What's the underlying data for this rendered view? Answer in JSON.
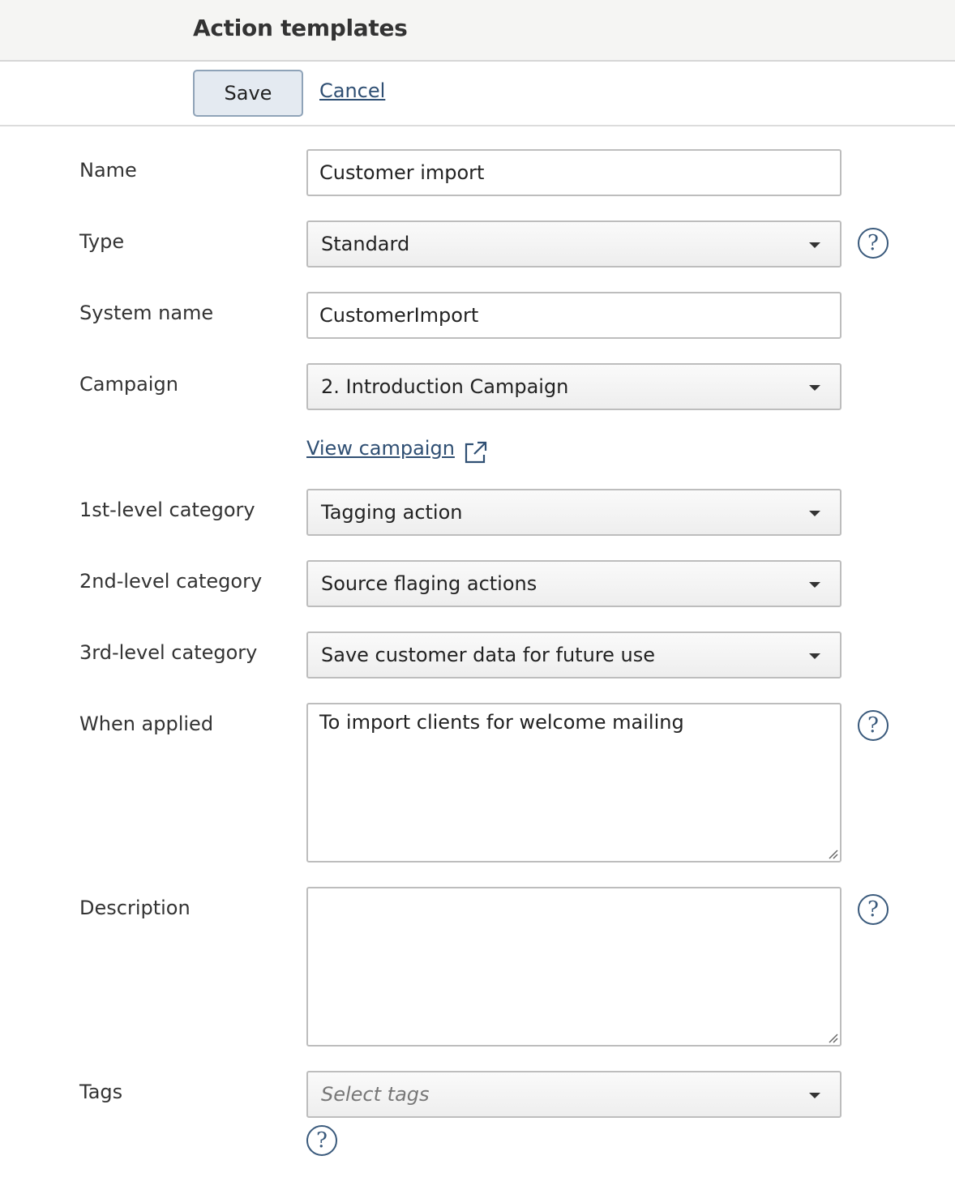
{
  "header": {
    "title": "Action templates"
  },
  "toolbar": {
    "save_label": "Save",
    "cancel_label": "Cancel"
  },
  "form": {
    "name": {
      "label": "Name",
      "value": "Customer import"
    },
    "type": {
      "label": "Type",
      "value": "Standard"
    },
    "system_name": {
      "label": "System name",
      "value": "CustomerImport"
    },
    "campaign": {
      "label": "Campaign",
      "value": "2. Introduction Campaign",
      "view_link": "View campaign"
    },
    "category1": {
      "label": "1st-level category",
      "value": "Tagging action"
    },
    "category2": {
      "label": "2nd-level category",
      "value": "Source flaging actions"
    },
    "category3": {
      "label": "3rd-level category",
      "value": "Save customer data for future use"
    },
    "when_applied": {
      "label": "When applied",
      "value": "To import clients for welcome mailing"
    },
    "description": {
      "label": "Description",
      "value": ""
    },
    "tags": {
      "label": "Tags",
      "placeholder": "Select tags"
    }
  },
  "help_icon_glyph": "?",
  "colors": {
    "accent": "#2f4f73",
    "save_bg": "#e4eaf1",
    "header_bg": "#f5f5f3"
  },
  "icons": [
    "help-icon",
    "external-link-icon",
    "chevron-down-icon",
    "resize-handle-icon"
  ]
}
